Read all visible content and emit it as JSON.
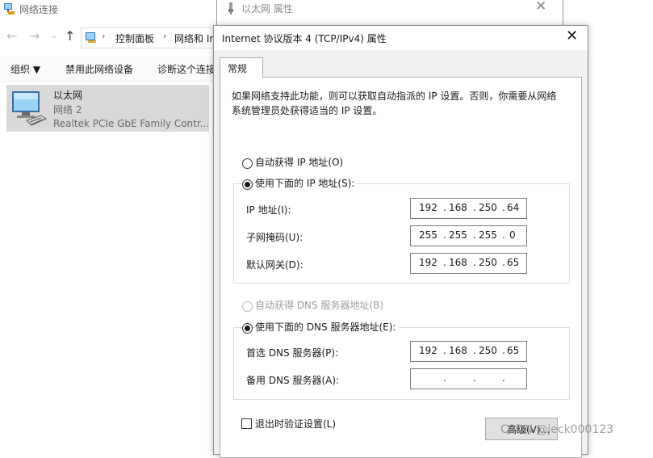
{
  "explorer": {
    "title": "网络连接",
    "address_segments": [
      "控制面板",
      "网络和 In"
    ],
    "commands": [
      "组织 ▼",
      "禁用此网络设备",
      "诊断这个连接"
    ],
    "adapter": {
      "name": "以太网",
      "network": "网络 2",
      "device": "Realtek PCIe GbE Family Contr..."
    }
  },
  "props_window": {
    "title": "以太网 属性"
  },
  "dialog": {
    "title": "Internet 协议版本 4 (TCP/IPv4) 属性",
    "tab": "常规",
    "description": "如果网络支持此功能，则可以获取自动指派的 IP 设置。否则，你需要从网络系统管理员处获得适当的 IP 设置。",
    "auto_ip_label": "自动获得 IP 地址(O)",
    "manual_ip_label": "使用下面的 IP 地址(S):",
    "ip_label": "IP 地址(I):",
    "subnet_label": "子网掩码(U):",
    "gateway_label": "默认网关(D):",
    "ip": [
      "192",
      "168",
      "250",
      "64"
    ],
    "subnet": [
      "255",
      "255",
      "255",
      "0"
    ],
    "gateway": [
      "192",
      "168",
      "250",
      "65"
    ],
    "auto_dns_label": "自动获得 DNS 服务器地址(B)",
    "manual_dns_label": "使用下面的 DNS 服务器地址(E):",
    "preferred_dns_label": "首选 DNS 服务器(P):",
    "alternate_dns_label": "备用 DNS 服务器(A):",
    "preferred_dns": [
      "192",
      "168",
      "250",
      "65"
    ],
    "alternate_dns": [
      "",
      "",
      "",
      ""
    ],
    "validate_label": "退出时验证设置(L)",
    "advanced_label": "高级(V)...",
    "ip_mode": "manual",
    "dns_mode": "manual",
    "validate_checked": false
  },
  "watermark": "CSDN @jeck000123"
}
